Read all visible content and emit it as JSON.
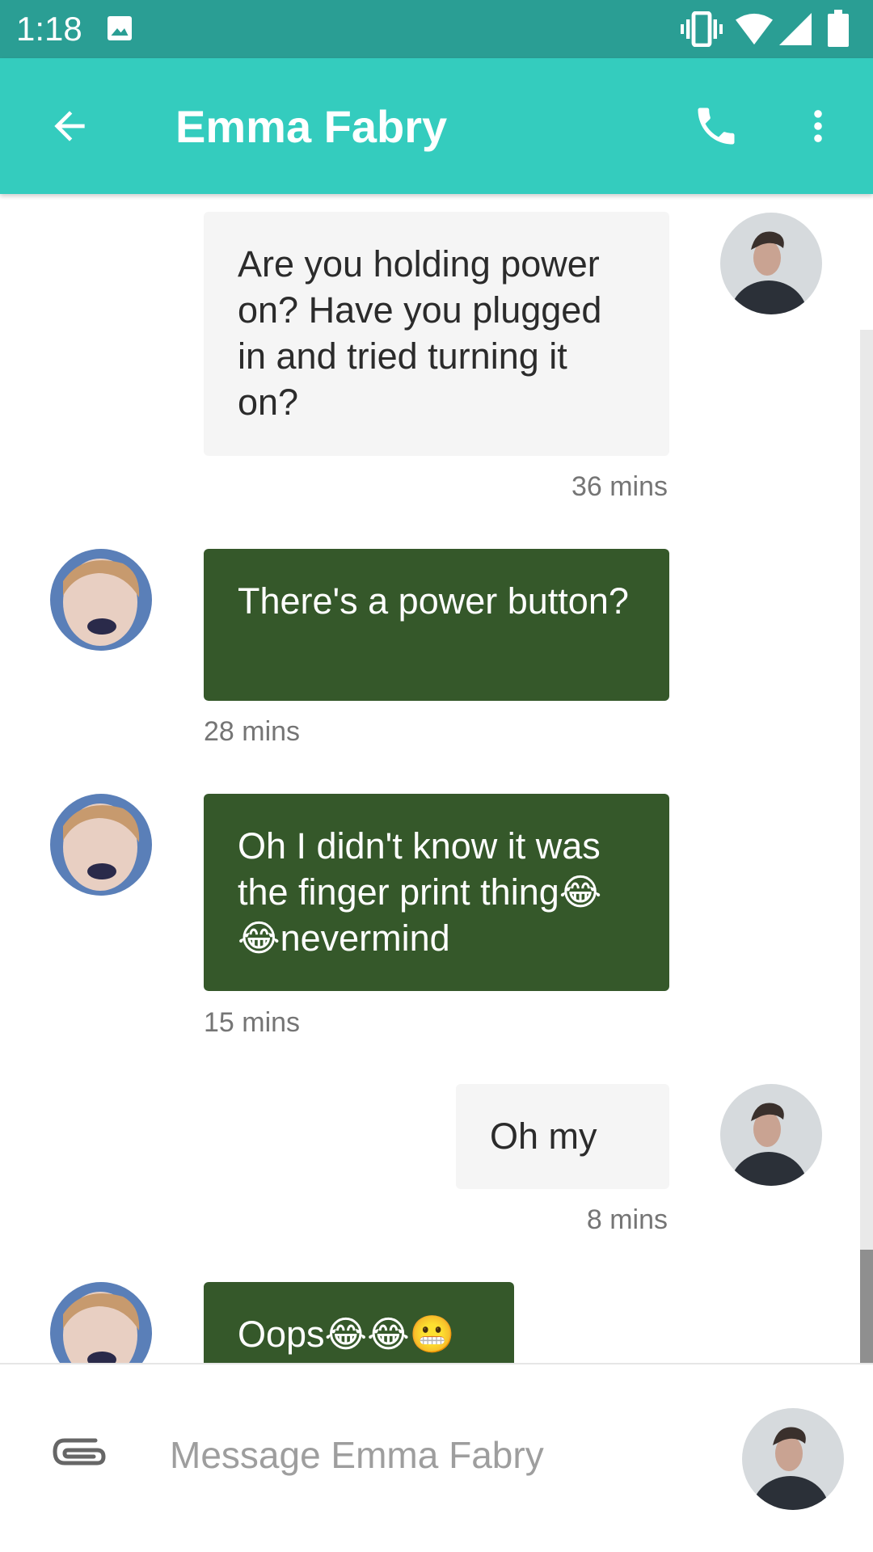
{
  "status_bar": {
    "time": "1:18",
    "icons": [
      "image-icon",
      "vibrate-icon",
      "wifi-icon",
      "signal-icon",
      "battery-icon"
    ]
  },
  "toolbar": {
    "title": "Emma Fabry",
    "back_icon": "arrow-left-icon",
    "call_icon": "phone-icon",
    "more_icon": "more-vert-icon"
  },
  "messages": [
    {
      "direction": "outgoing",
      "text": "Are you holding power on? Have you plugged in and tried turning it on?",
      "time": "36 mins"
    },
    {
      "direction": "incoming",
      "text": "There's a power button?",
      "time": "28 mins"
    },
    {
      "direction": "incoming",
      "text": "Oh I didn't know it was the finger print thing😂😂nevermind",
      "time": "15 mins"
    },
    {
      "direction": "outgoing",
      "text": "Oh my",
      "time": "8 mins"
    },
    {
      "direction": "incoming",
      "text": "Oops😂😂😬",
      "time": ""
    }
  ],
  "composer": {
    "placeholder": "Message Emma Fabry",
    "value": "",
    "attach_icon": "paperclip-icon"
  },
  "colors": {
    "status_bar": "#2a9e94",
    "toolbar": "#34ccbe",
    "incoming_bubble": "#35582a",
    "outgoing_bubble": "#f5f5f5",
    "timestamp": "#757575"
  }
}
